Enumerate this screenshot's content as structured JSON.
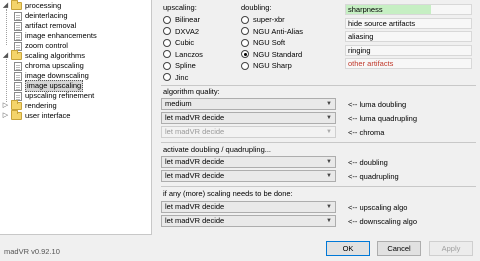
{
  "tree": {
    "processing": "processing",
    "deinterlacing": "deinterlacing",
    "artifact_removal": "artifact removal",
    "image_enhancements": "image enhancements",
    "zoom_control": "zoom control",
    "scaling_algorithms": "scaling algorithms",
    "chroma_upscaling": "chroma upscaling",
    "image_downscaling": "image downscaling",
    "image_upscaling": "image upscaling",
    "upscaling_refinement": "upscaling refinement",
    "rendering": "rendering",
    "user_interface": "user interface"
  },
  "version": "madVR v0.92.10",
  "upscaling": {
    "label": "upscaling:",
    "options": [
      "Bilinear",
      "DXVA2",
      "Cubic",
      "Lanczos",
      "Spline",
      "Jinc"
    ]
  },
  "doubling": {
    "label": "doubling:",
    "options": [
      "super-xbr",
      "NGU Anti-Alias",
      "NGU Soft",
      "NGU Standard",
      "NGU Sharp"
    ],
    "selected": "NGU Standard"
  },
  "artifacts": [
    {
      "label": "sharpness",
      "level": 0.68,
      "color": "#c6efc3"
    },
    {
      "label": "hide source artifacts",
      "level": 0,
      "color": "#000000"
    },
    {
      "label": "aliasing",
      "level": 0,
      "color": "#000000"
    },
    {
      "label": "ringing",
      "level": 0,
      "color": "#000000"
    },
    {
      "label": "other artifacts",
      "level": 0,
      "color": "#c0392b"
    }
  ],
  "algorithm_quality": {
    "label": "algorithm quality:",
    "rows": [
      {
        "value": "medium",
        "arrow": "<-- luma doubling"
      },
      {
        "value": "let madVR decide",
        "arrow": "<-- luma quadrupling"
      },
      {
        "value": "let madVR decide",
        "arrow": "<-- chroma"
      }
    ]
  },
  "activate": {
    "label": "activate doubling / quadrupling...",
    "rows": [
      {
        "value": "let madVR decide",
        "arrow": "<-- doubling"
      },
      {
        "value": "let madVR decide",
        "arrow": "<-- quadrupling"
      }
    ]
  },
  "more_scaling": {
    "label": "if any (more) scaling needs to be done:",
    "rows": [
      {
        "value": "let madVR decide",
        "arrow": "<-- upscaling algo"
      },
      {
        "value": "let madVR decide",
        "arrow": "<-- downscaling algo"
      }
    ]
  },
  "buttons": {
    "ok": "OK",
    "cancel": "Cancel",
    "apply": "Apply"
  }
}
